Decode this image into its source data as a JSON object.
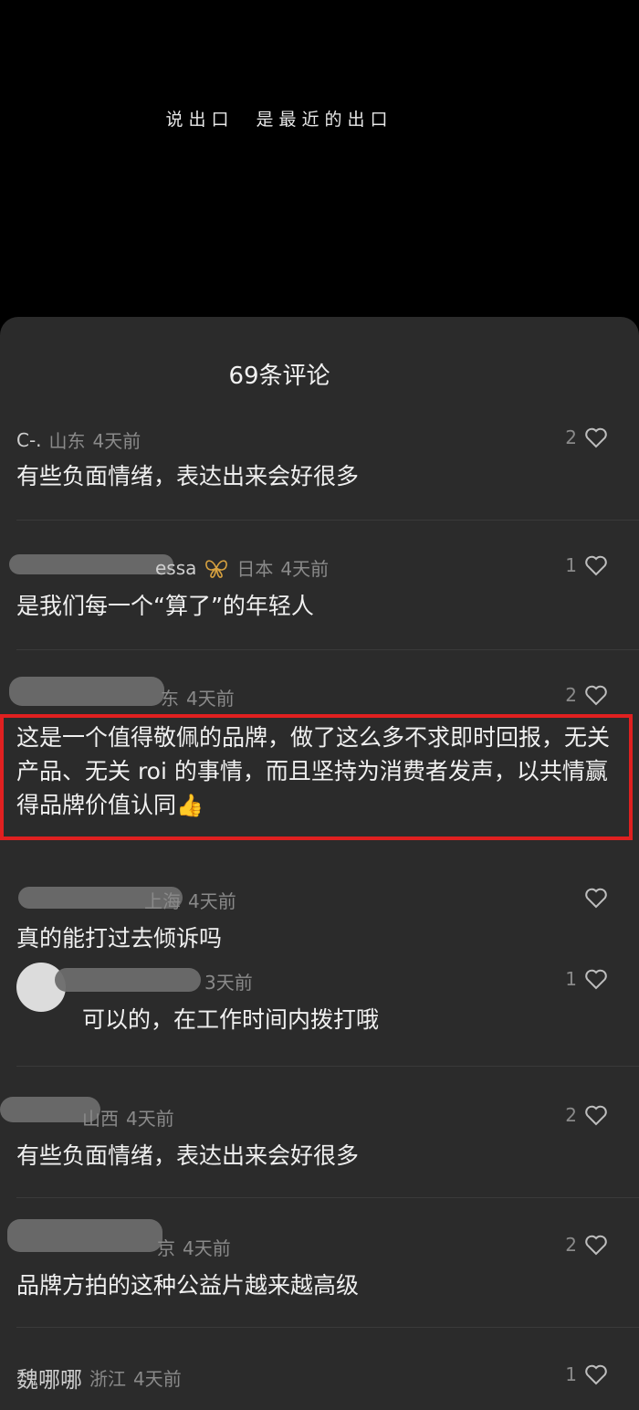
{
  "video": {
    "caption": "说出口  是最近的出口"
  },
  "sheet": {
    "title": "69条评论"
  },
  "comments": [
    {
      "name": "C-.",
      "region": "山东",
      "time": "4天前",
      "likes": "2",
      "text": "有些负面情绪，表达出来会好很多"
    },
    {
      "name": "essa",
      "region": "日本",
      "time": "4天前",
      "likes": "1",
      "text": "是我们每一个“算了”的年轻人"
    },
    {
      "name": "",
      "region": "东",
      "time": "4天前",
      "likes": "2",
      "text": "这是一个值得敬佩的品牌，做了这么多不求即时回报，无关产品、无关 roi 的事情，而且坚持为消费者发声，以共情赢得品牌价值认同"
    },
    {
      "name": "",
      "region": "上海",
      "time": "4天前",
      "likes": "",
      "text": "真的能打过去倾诉吗"
    },
    {
      "name": "",
      "region": "",
      "time": "3天前",
      "likes": "1",
      "text": "可以的，在工作时间内拨打哦"
    },
    {
      "name": "",
      "region": "山西",
      "time": "4天前",
      "likes": "2",
      "text": "有些负面情绪，表达出来会好很多"
    },
    {
      "name": "",
      "region": "京",
      "time": "4天前",
      "likes": "2",
      "text": "品牌方拍的这种公益片越来越高级"
    },
    {
      "name": "魏哪哪",
      "region": "浙江",
      "time": "4天前",
      "likes": "1",
      "text": ""
    }
  ],
  "icons": {
    "like": "heart-outline-icon",
    "badge": "butterfly-badge-icon",
    "thumbs_up": "thumbs-up-emoji"
  },
  "colors": {
    "highlight": "#e02020",
    "sheet_bg": "#2b2b2b"
  }
}
